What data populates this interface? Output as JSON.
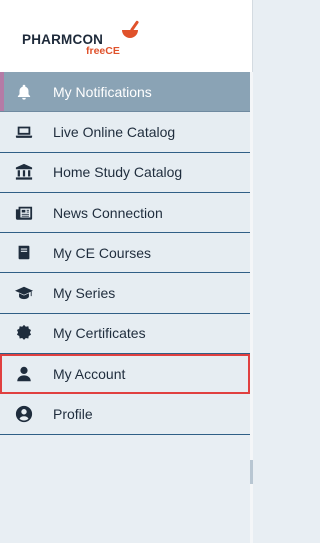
{
  "brand": {
    "name": "PHARMCON",
    "sub": "freeCE",
    "accent_color": "#e0522b"
  },
  "menu": {
    "items": [
      {
        "label": "My Notifications",
        "icon": "bell-icon",
        "active": true
      },
      {
        "label": "Live Online Catalog",
        "icon": "laptop-icon"
      },
      {
        "label": "Home Study Catalog",
        "icon": "bank-icon"
      },
      {
        "label": "News Connection",
        "icon": "newspaper-icon"
      },
      {
        "label": "My CE Courses",
        "icon": "book-icon"
      },
      {
        "label": "My Series",
        "icon": "graduation-cap-icon"
      },
      {
        "label": "My Certificates",
        "icon": "certificate-icon"
      },
      {
        "label": "My Account",
        "icon": "user-icon",
        "highlighted": true
      },
      {
        "label": "Profile",
        "icon": "user-circle-icon"
      }
    ]
  },
  "colors": {
    "active_bg": "#8aa3b5",
    "divider": "#2f5f86",
    "highlight_border": "#e04040"
  }
}
